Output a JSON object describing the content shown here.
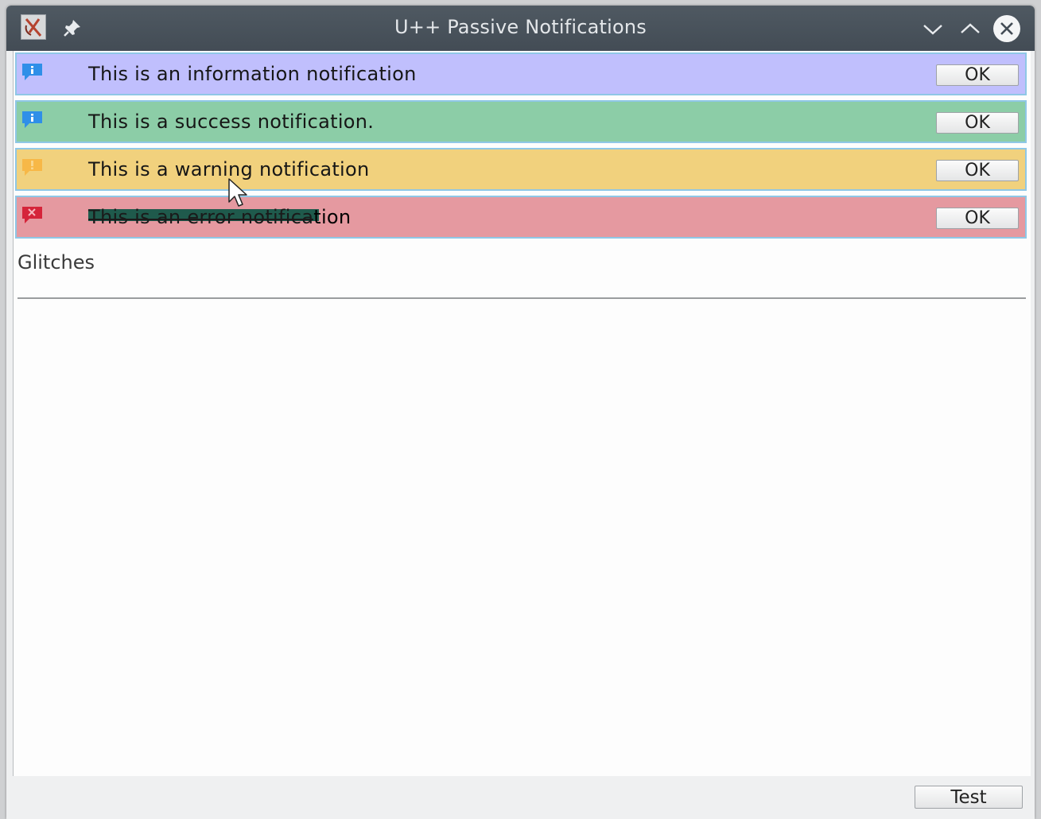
{
  "window": {
    "title": "U++ Passive Notifications",
    "icons": {
      "app": "app-icon",
      "pin": "pin-icon",
      "minimize": "chevron-down-icon",
      "maximize": "chevron-up-icon",
      "close": "close-icon"
    }
  },
  "notifications": [
    {
      "type": "info",
      "text": "This is an information notification",
      "button": "OK",
      "icon": "info-icon",
      "color": "#c0bffd"
    },
    {
      "type": "success",
      "text": "This is a success notification.",
      "button": "OK",
      "icon": "info-icon",
      "color": "#8ccda7"
    },
    {
      "type": "warning",
      "text": "This is a warning notification",
      "button": "OK",
      "icon": "warning-icon",
      "color": "#f1d17d"
    },
    {
      "type": "error",
      "text_struck": "This is an error notifica",
      "text_rest": "tion",
      "button": "OK",
      "icon": "error-icon",
      "color": "#e599a0"
    }
  ],
  "section": {
    "label": "Glitches"
  },
  "footer": {
    "test_label": "Test"
  }
}
